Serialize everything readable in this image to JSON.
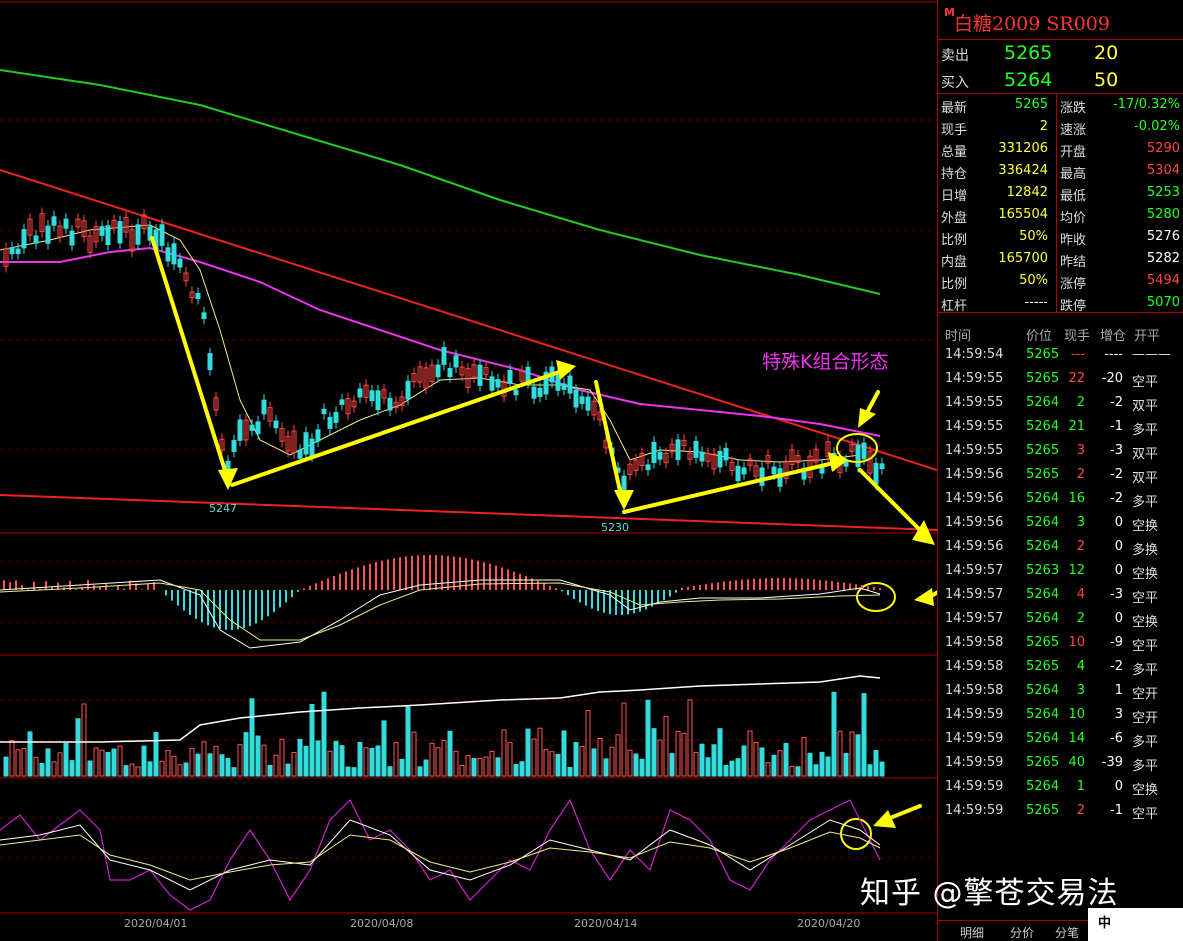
{
  "quote": {
    "mark": "M",
    "title": "白糖2009  SR009",
    "ask_label": "卖出",
    "ask_price": "5265",
    "ask_qty": "20",
    "bid_label": "买入",
    "bid_price": "5264",
    "bid_qty": "50"
  },
  "stats": [
    {
      "l1": "最新",
      "v1": "5265",
      "c1": "green",
      "l2": "涨跌",
      "v2": "-17/0.32%",
      "c2": "green"
    },
    {
      "l1": "现手",
      "v1": "2",
      "c1": "yellow",
      "l2": "速涨",
      "v2": "-0.02%",
      "c2": "green"
    },
    {
      "l1": "总量",
      "v1": "331206",
      "c1": "yellow",
      "l2": "开盘",
      "v2": "5290",
      "c2": "red"
    },
    {
      "l1": "持仓",
      "v1": "336424",
      "c1": "yellow",
      "l2": "最高",
      "v2": "5304",
      "c2": "red"
    },
    {
      "l1": "日增",
      "v1": "12842",
      "c1": "yellow",
      "l2": "最低",
      "v2": "5253",
      "c2": "green"
    },
    {
      "l1": "外盘",
      "v1": "165504",
      "c1": "yellow",
      "l2": "均价",
      "v2": "5280",
      "c2": "green"
    },
    {
      "l1": "比例",
      "v1": "50%",
      "c1": "yellow",
      "l2": "昨收",
      "v2": "5276",
      "c2": "white"
    },
    {
      "l1": "内盘",
      "v1": "165700",
      "c1": "yellow",
      "l2": "昨结",
      "v2": "5282",
      "c2": "white"
    },
    {
      "l1": "比例",
      "v1": "50%",
      "c1": "yellow",
      "l2": "涨停",
      "v2": "5494",
      "c2": "red"
    },
    {
      "l1": "杠杆",
      "v1": "-----",
      "c1": "white",
      "l2": "跌停",
      "v2": "5070",
      "c2": "green"
    }
  ],
  "ticks_header": {
    "time": "时间",
    "price": "价位",
    "vol": "现手",
    "oi": "增仓",
    "nature": "开平"
  },
  "ticks": [
    {
      "t": "14:59:54",
      "p": "5265",
      "v": "---",
      "o": "----",
      "n": "———",
      "pc": "green",
      "vc": "red",
      "oc": "white"
    },
    {
      "t": "14:59:55",
      "p": "5265",
      "v": "22",
      "o": "-20",
      "n": "空平",
      "pc": "green",
      "vc": "red",
      "oc": "white"
    },
    {
      "t": "14:59:55",
      "p": "5264",
      "v": "2",
      "o": "-2",
      "n": "双平",
      "pc": "green",
      "vc": "green",
      "oc": "white"
    },
    {
      "t": "14:59:55",
      "p": "5264",
      "v": "21",
      "o": "-1",
      "n": "多平",
      "pc": "green",
      "vc": "green",
      "oc": "white"
    },
    {
      "t": "14:59:55",
      "p": "5265",
      "v": "3",
      "o": "-3",
      "n": "双平",
      "pc": "green",
      "vc": "red",
      "oc": "white"
    },
    {
      "t": "14:59:56",
      "p": "5265",
      "v": "2",
      "o": "-2",
      "n": "双平",
      "pc": "green",
      "vc": "red",
      "oc": "white"
    },
    {
      "t": "14:59:56",
      "p": "5264",
      "v": "16",
      "o": "-2",
      "n": "多平",
      "pc": "green",
      "vc": "green",
      "oc": "white"
    },
    {
      "t": "14:59:56",
      "p": "5264",
      "v": "3",
      "o": "0",
      "n": "空换",
      "pc": "green",
      "vc": "green",
      "oc": "white"
    },
    {
      "t": "14:59:56",
      "p": "5264",
      "v": "2",
      "o": "0",
      "n": "多换",
      "pc": "green",
      "vc": "red",
      "oc": "white"
    },
    {
      "t": "14:59:57",
      "p": "5263",
      "v": "12",
      "o": "0",
      "n": "空换",
      "pc": "green",
      "vc": "green",
      "oc": "white"
    },
    {
      "t": "14:59:57",
      "p": "5264",
      "v": "4",
      "o": "-3",
      "n": "空平",
      "pc": "green",
      "vc": "red",
      "oc": "white"
    },
    {
      "t": "14:59:57",
      "p": "5264",
      "v": "2",
      "o": "0",
      "n": "空换",
      "pc": "green",
      "vc": "green",
      "oc": "white"
    },
    {
      "t": "14:59:58",
      "p": "5265",
      "v": "10",
      "o": "-9",
      "n": "空平",
      "pc": "green",
      "vc": "red",
      "oc": "white"
    },
    {
      "t": "14:59:58",
      "p": "5265",
      "v": "4",
      "o": "-2",
      "n": "多平",
      "pc": "green",
      "vc": "green",
      "oc": "white"
    },
    {
      "t": "14:59:58",
      "p": "5264",
      "v": "3",
      "o": "1",
      "n": "空开",
      "pc": "green",
      "vc": "green",
      "oc": "white"
    },
    {
      "t": "14:59:59",
      "p": "5264",
      "v": "10",
      "o": "3",
      "n": "空开",
      "pc": "green",
      "vc": "green",
      "oc": "white"
    },
    {
      "t": "14:59:59",
      "p": "5264",
      "v": "14",
      "o": "-6",
      "n": "多平",
      "pc": "green",
      "vc": "green",
      "oc": "white"
    },
    {
      "t": "14:59:59",
      "p": "5265",
      "v": "40",
      "o": "-39",
      "n": "多平",
      "pc": "green",
      "vc": "green",
      "oc": "white"
    },
    {
      "t": "14:59:59",
      "p": "5264",
      "v": "1",
      "o": "0",
      "n": "空换",
      "pc": "green",
      "vc": "green",
      "oc": "white"
    },
    {
      "t": "14:59:59",
      "p": "5265",
      "v": "2",
      "o": "-1",
      "n": "空平",
      "pc": "green",
      "vc": "red",
      "oc": "white"
    }
  ],
  "tabs": [
    "明细",
    "分价",
    "分笔"
  ],
  "chart": {
    "x_dates": [
      "2020/04/01",
      "2020/04/08",
      "2020/04/14",
      "2020/04/20"
    ],
    "low_labels": [
      "5247",
      "5230"
    ],
    "annotation": "特殊K组合形态"
  },
  "watermark": "知乎 @擎苍交易法",
  "corner": "中"
}
